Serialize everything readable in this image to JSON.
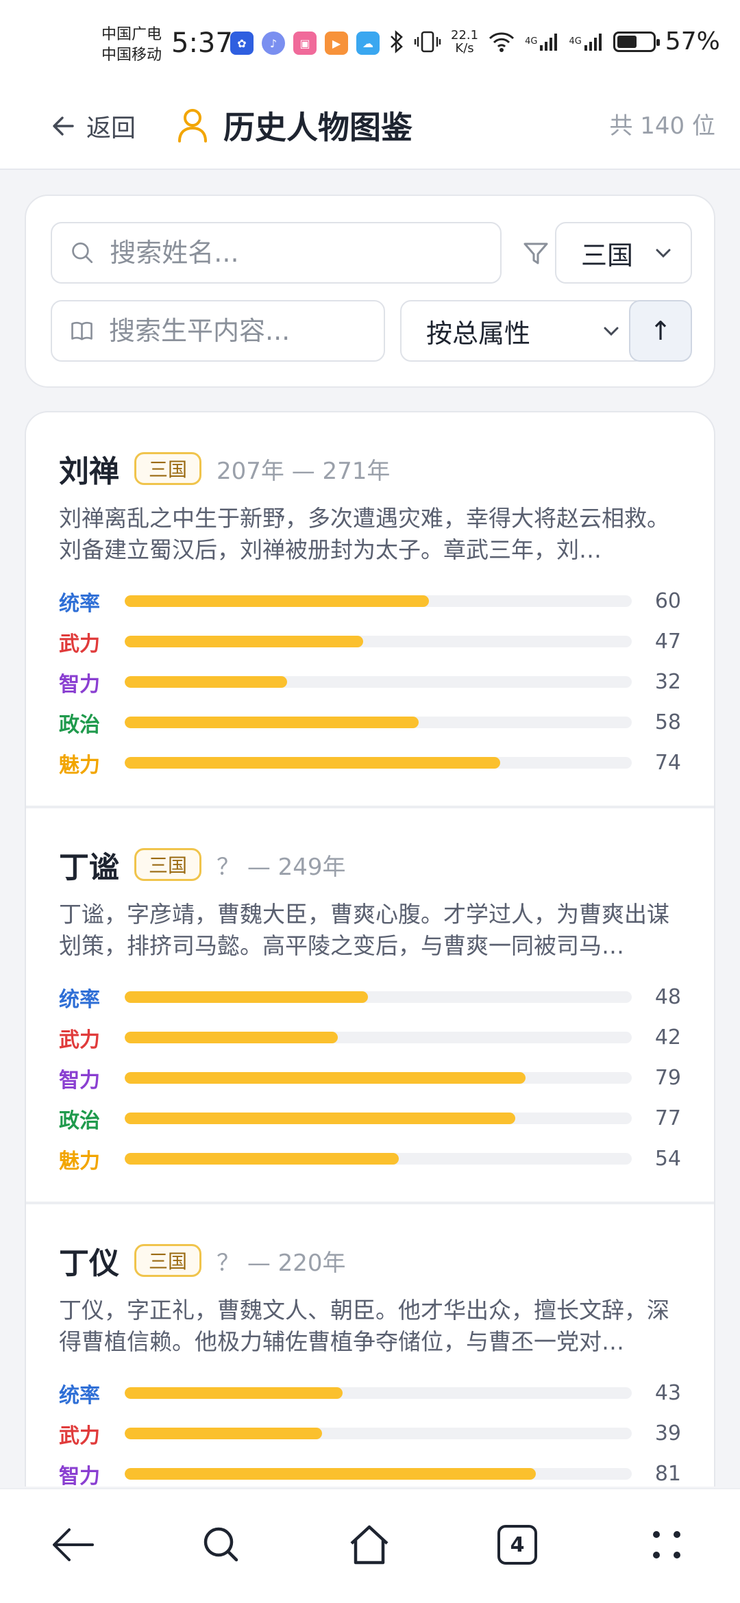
{
  "status_bar": {
    "carrier_1": "中国广电",
    "carrier_2": "中国移动",
    "time": "5:37",
    "speed_value": "22.1",
    "speed_unit": "K/s",
    "signal_1": "4G",
    "signal_2": "4G",
    "battery_level": 0.57,
    "battery_text": "57%"
  },
  "header": {
    "back_label": "返回",
    "title": "历史人物图鉴",
    "count": "共 140 位"
  },
  "filters": {
    "name_placeholder": "搜索姓名...",
    "dynasty_value": "三国",
    "bio_placeholder": "搜索生平内容...",
    "sort_value": "按总属性",
    "sort_direction": "↑"
  },
  "stat_labels": {
    "command": "统率",
    "force": "武力",
    "intellect": "智力",
    "politics": "政治",
    "charm": "魅力"
  },
  "colors": {
    "command": "#2f6fd6",
    "force": "#e03b3b",
    "intellect": "#8a3fd1",
    "politics": "#1f9a4c",
    "charm": "#f2a500",
    "bar": "#fbc02d",
    "accent": "#f2a500"
  },
  "people": [
    {
      "name": "刘禅",
      "dynasty": "三国",
      "years": "207年 — 271年",
      "bio": "刘禅离乱之中生于新野，多次遭遇灾难，幸得大将赵云相救。刘备建立蜀汉后，刘禅被册封为太子。章武三年，刘…",
      "stats": {
        "command": "60",
        "force": "47",
        "intellect": "32",
        "politics": "58",
        "charm": "74"
      }
    },
    {
      "name": "丁谧",
      "dynasty": "三国",
      "years": "？ — 249年",
      "bio": "丁谧，字彦靖，曹魏大臣，曹爽心腹。才学过人，为曹爽出谋划策，排挤司马懿。高平陵之变后，与曹爽一同被司马…",
      "stats": {
        "command": "48",
        "force": "42",
        "intellect": "79",
        "politics": "77",
        "charm": "54"
      }
    },
    {
      "name": "丁仪",
      "dynasty": "三国",
      "years": "？ — 220年",
      "bio": "丁仪，字正礼，曹魏文人、朝臣。他才华出众，擅长文辞，深得曹植信赖。他极力辅佐曹植争夺储位，与曹丕一党对…",
      "stats": {
        "command": "43",
        "force": "39",
        "intellect": "81",
        "politics": "",
        "charm": ""
      }
    }
  ],
  "bottom_nav": {
    "tabs_count": "4"
  }
}
